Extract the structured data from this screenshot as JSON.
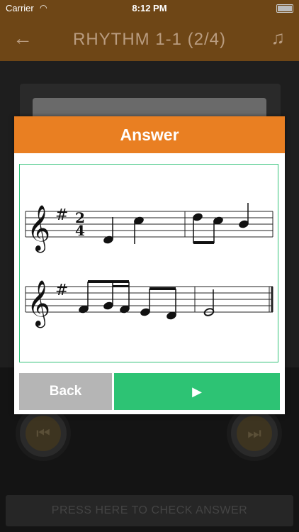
{
  "status_bar": {
    "carrier": "Carrier",
    "time": "8:12 PM"
  },
  "header": {
    "title": "RHYTHM 1-1 (2/4)",
    "back_icon": "arrow-left-icon",
    "music_icon": "music-note-icon"
  },
  "dialog": {
    "title": "Answer",
    "back_label": "Back",
    "next_icon": "play-triangle-icon",
    "time_signature": {
      "top": "2",
      "bottom": "4"
    },
    "key_signature": "#"
  },
  "controls": {
    "prev_icon": "skip-back-icon",
    "next_icon": "skip-forward-icon"
  },
  "footer": {
    "check_answer_label": "PRESS HERE TO CHECK ANSWER"
  },
  "colors": {
    "accent": "#e97f22",
    "header_bg": "#6e4616",
    "confirm": "#2dc374",
    "back": "#b5b5b5",
    "frame": "#33c27a"
  }
}
